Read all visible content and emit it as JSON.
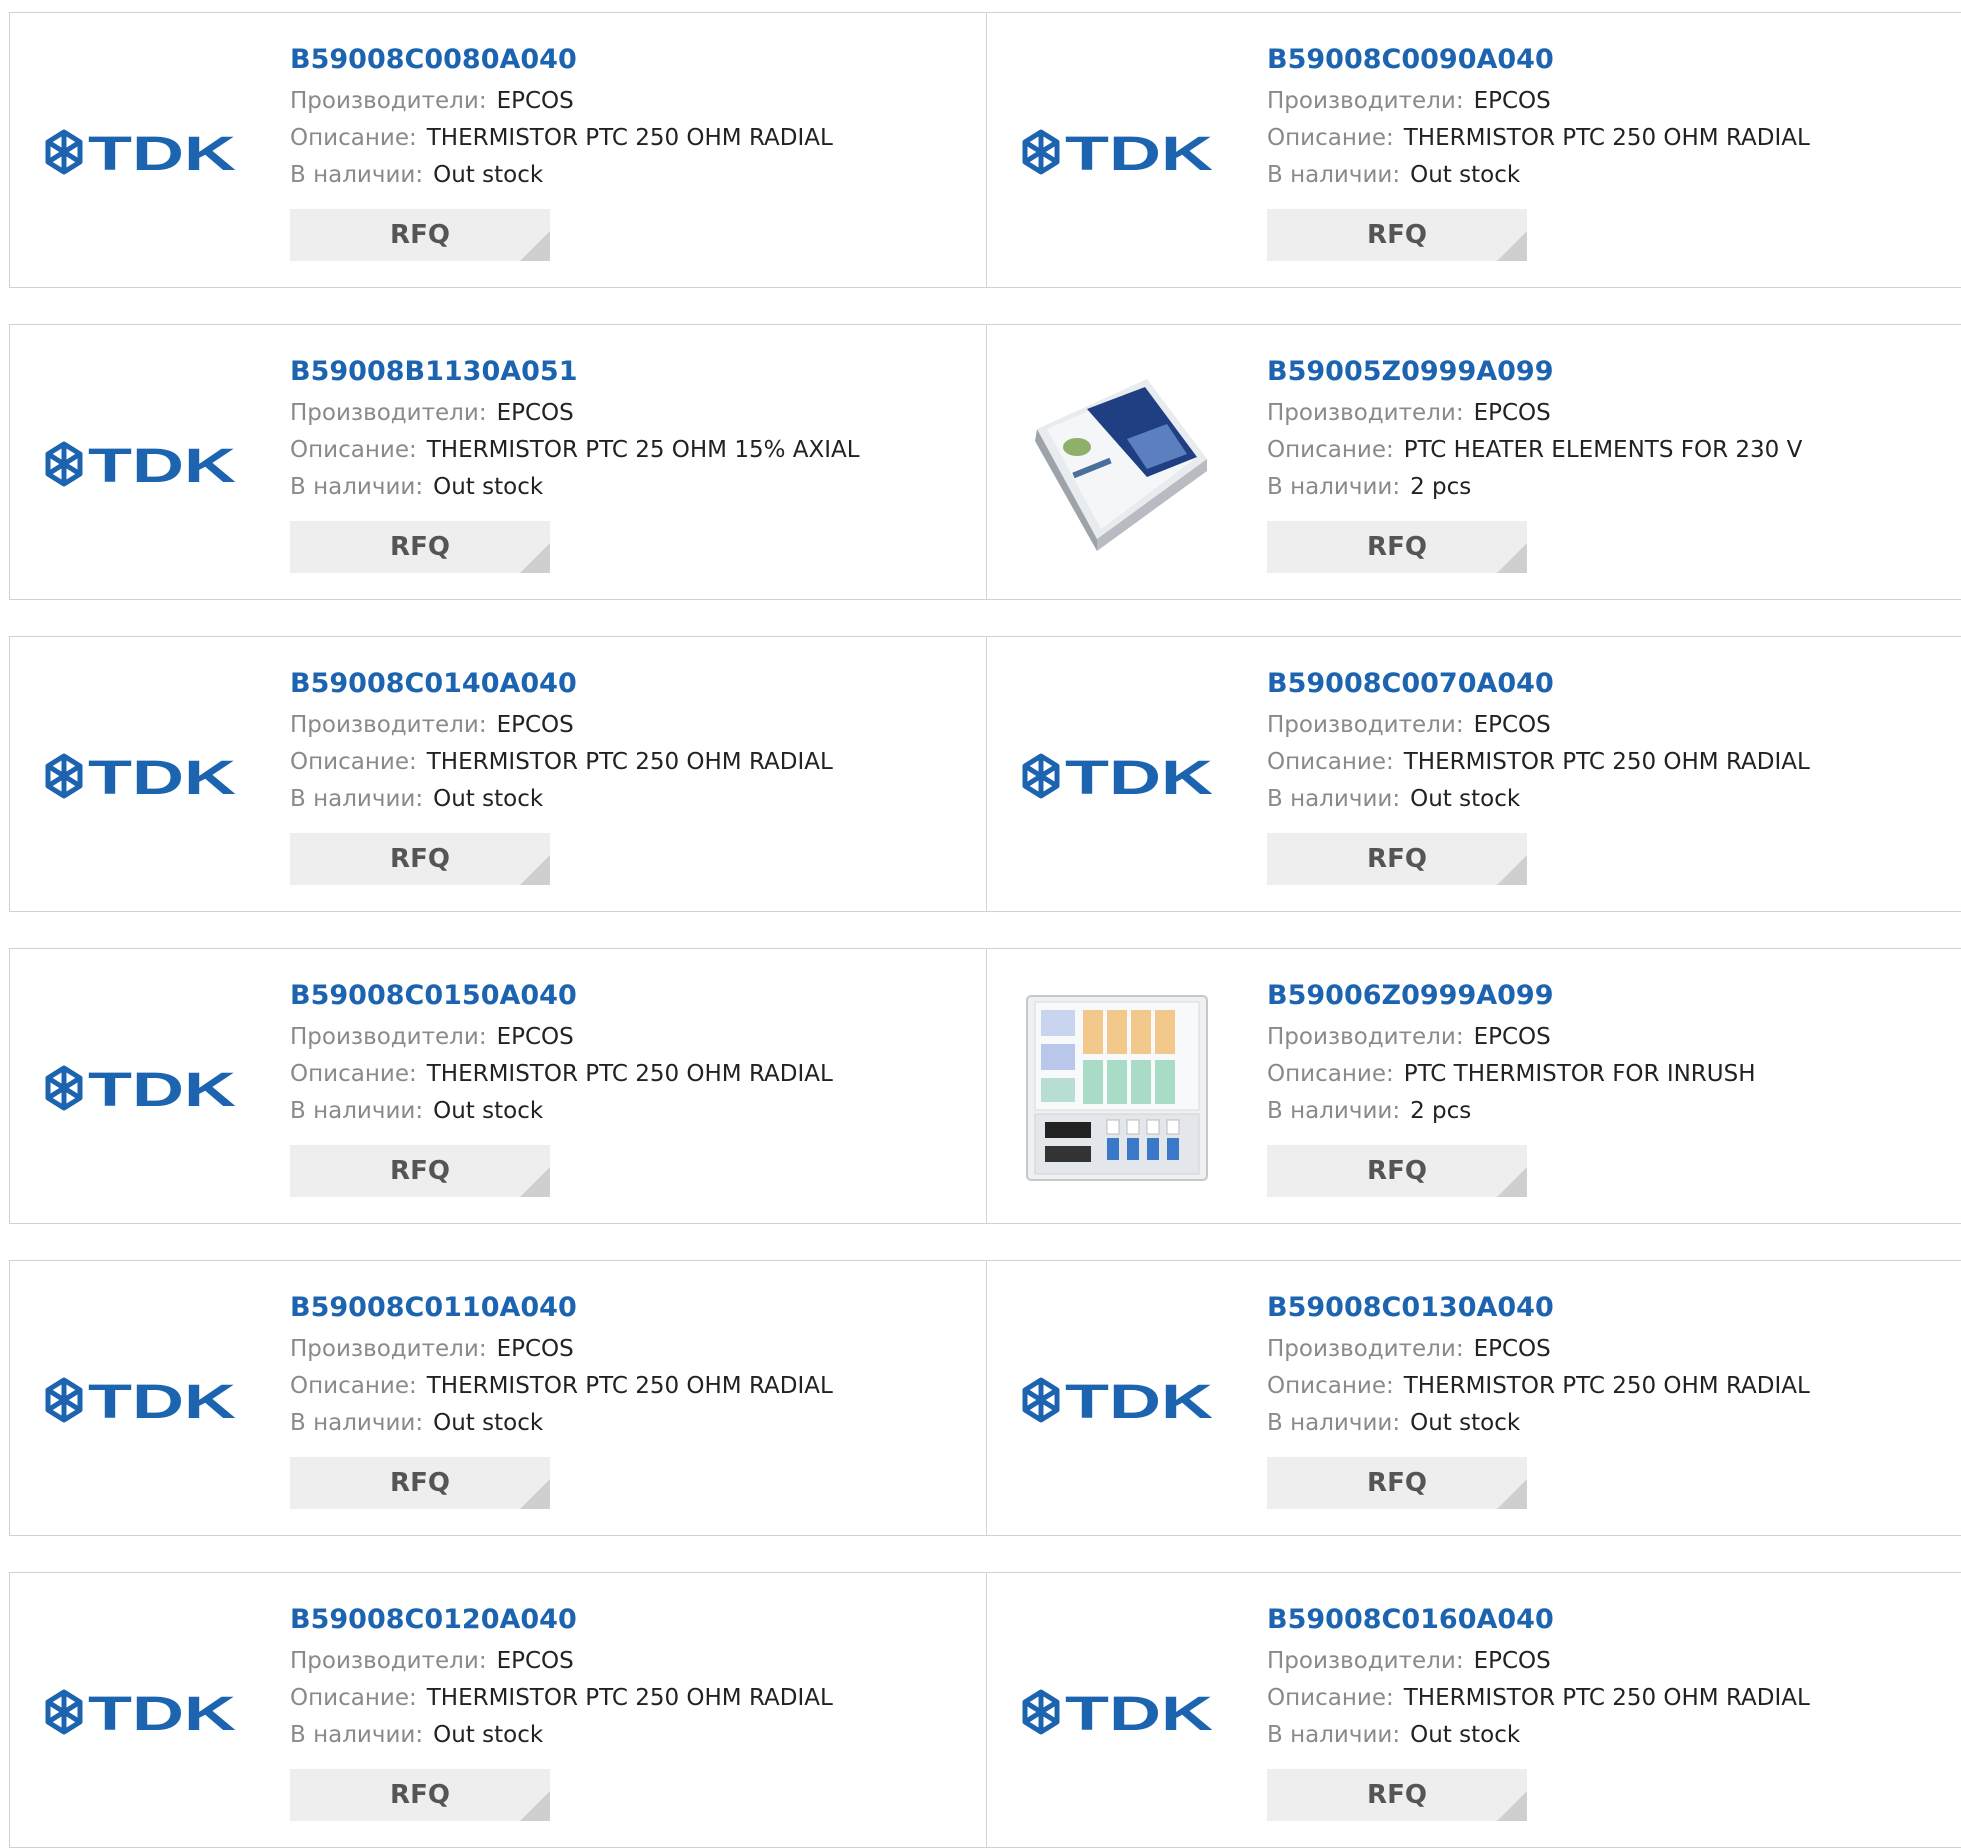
{
  "labels": {
    "manufacturer": "Производители:",
    "description": "Описание:",
    "stock": "В наличии:",
    "rfq": "RFQ"
  },
  "products": [
    {
      "part": "B59008C0080A040",
      "manufacturer": "EPCOS",
      "description": "THERMISTOR PTC 250 OHM RADIAL",
      "stock": "Out stock",
      "image": "tdk-logo"
    },
    {
      "part": "B59008C0090A040",
      "manufacturer": "EPCOS",
      "description": "THERMISTOR PTC 250 OHM RADIAL",
      "stock": "Out stock",
      "image": "tdk-logo"
    },
    {
      "part": "B59008B1130A051",
      "manufacturer": "EPCOS",
      "description": "THERMISTOR PTC 25 OHM 15% AXIAL",
      "stock": "Out stock",
      "image": "tdk-logo"
    },
    {
      "part": "B59005Z0999A099",
      "manufacturer": "EPCOS",
      "description": "PTC HEATER ELEMENTS FOR 230 V",
      "stock": "2 pcs",
      "image": "kit-box-photo"
    },
    {
      "part": "B59008C0140A040",
      "manufacturer": "EPCOS",
      "description": "THERMISTOR PTC 250 OHM RADIAL",
      "stock": "Out stock",
      "image": "tdk-logo"
    },
    {
      "part": "B59008C0070A040",
      "manufacturer": "EPCOS",
      "description": "THERMISTOR PTC 250 OHM RADIAL",
      "stock": "Out stock",
      "image": "tdk-logo"
    },
    {
      "part": "B59008C0150A040",
      "manufacturer": "EPCOS",
      "description": "THERMISTOR PTC 250 OHM RADIAL",
      "stock": "Out stock",
      "image": "tdk-logo"
    },
    {
      "part": "B59006Z0999A099",
      "manufacturer": "EPCOS",
      "description": "PTC THERMISTOR FOR INRUSH",
      "stock": "2 pcs",
      "image": "kit-case-photo"
    },
    {
      "part": "B59008C0110A040",
      "manufacturer": "EPCOS",
      "description": "THERMISTOR PTC 250 OHM RADIAL",
      "stock": "Out stock",
      "image": "tdk-logo"
    },
    {
      "part": "B59008C0130A040",
      "manufacturer": "EPCOS",
      "description": "THERMISTOR PTC 250 OHM RADIAL",
      "stock": "Out stock",
      "image": "tdk-logo"
    },
    {
      "part": "B59008C0120A040",
      "manufacturer": "EPCOS",
      "description": "THERMISTOR PTC 250 OHM RADIAL",
      "stock": "Out stock",
      "image": "tdk-logo"
    },
    {
      "part": "B59008C0160A040",
      "manufacturer": "EPCOS",
      "description": "THERMISTOR PTC 250 OHM RADIAL",
      "stock": "Out stock",
      "image": "tdk-logo"
    }
  ],
  "colors": {
    "link": "#1c64b0",
    "label": "#8a8a8a",
    "value": "#222222",
    "border": "#d2d2d2",
    "button_bg": "#eeeeee",
    "button_text": "#555555",
    "logo": "#1c64b0"
  }
}
